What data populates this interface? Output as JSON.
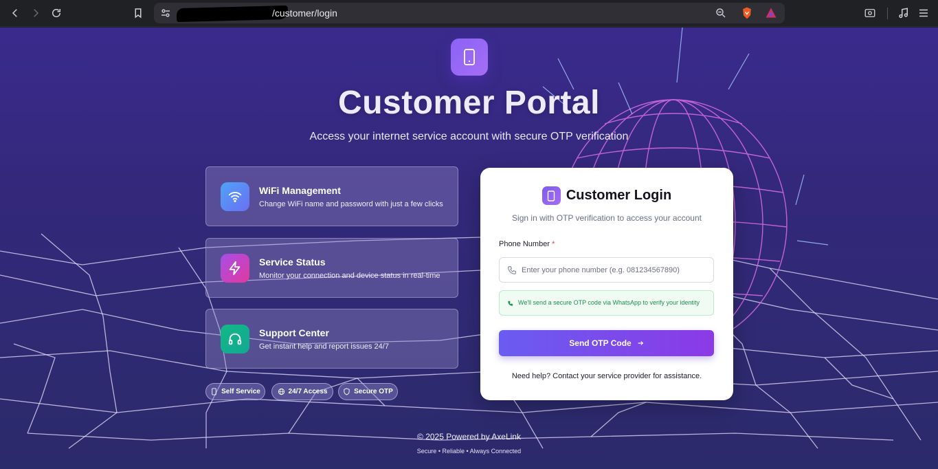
{
  "browser": {
    "url_path": "/customer/login"
  },
  "hero": {
    "title": "Customer Portal",
    "subtitle": "Access your internet service account with secure OTP verification"
  },
  "features": [
    {
      "title": "WiFi Management",
      "description": "Change WiFi name and password with just a few clicks",
      "icon": "wifi-icon",
      "color": "#5b8cf5"
    },
    {
      "title": "Service Status",
      "description": "Monitor your connection and device status in real-time",
      "icon": "lightning-icon",
      "color": "#c03fd6"
    },
    {
      "title": "Support Center",
      "description": "Get instant help and report issues 24/7",
      "icon": "headphones-icon",
      "color": "#12b58a"
    }
  ],
  "badges": [
    {
      "label": "Self Service",
      "icon": "phone-icon"
    },
    {
      "label": "24/7 Access",
      "icon": "globe-icon"
    },
    {
      "label": "Secure OTP",
      "icon": "shield-icon"
    }
  ],
  "login": {
    "title": "Customer Login",
    "subtitle": "Sign in with OTP verification to access your account",
    "phone_label": "Phone Number",
    "required_mark": "*",
    "phone_placeholder": "Enter your phone number (e.g. 081234567890)",
    "phone_value": "",
    "otp_note": "We'll send a secure OTP code via WhatsApp to verify your identity",
    "send_button": "Send OTP Code",
    "help_text": "Need help? Contact your service provider for assistance."
  },
  "footer": {
    "copyright": "© 2025 Powered by AxeLink",
    "tagline": "Secure • Reliable • Always Connected"
  },
  "colors": {
    "accent_start": "#6a5cf0",
    "accent_end": "#8b3ae6",
    "background": "#33287a",
    "success": "#1f8f4f"
  }
}
